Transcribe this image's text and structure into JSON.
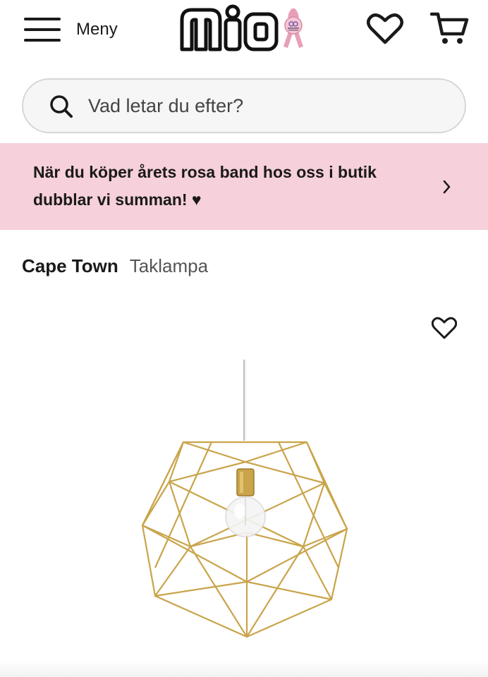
{
  "header": {
    "menu_label": "Meny",
    "menu_icon": "hamburger-icon",
    "logo_text": "mio",
    "logo_badge": "pink-ribbon-icon",
    "favorites_icon": "heart-icon",
    "cart_icon": "cart-icon"
  },
  "search": {
    "placeholder": "Vad letar du efter?",
    "icon": "search-icon"
  },
  "promo": {
    "text": "När du köper årets rosa band hos oss i butik dubblar vi summan! ♥",
    "icon": "chevron-right-icon",
    "background": "#f6d0da"
  },
  "product": {
    "brand": "Cape Town",
    "type": "Taklampa",
    "favorite_icon": "heart-icon",
    "image_icon": "pendant-lamp-image"
  },
  "colors": {
    "accent_pink": "#f6d0da",
    "ribbon_pink": "#e8a0b8",
    "lamp_gold": "#c9a44a"
  }
}
